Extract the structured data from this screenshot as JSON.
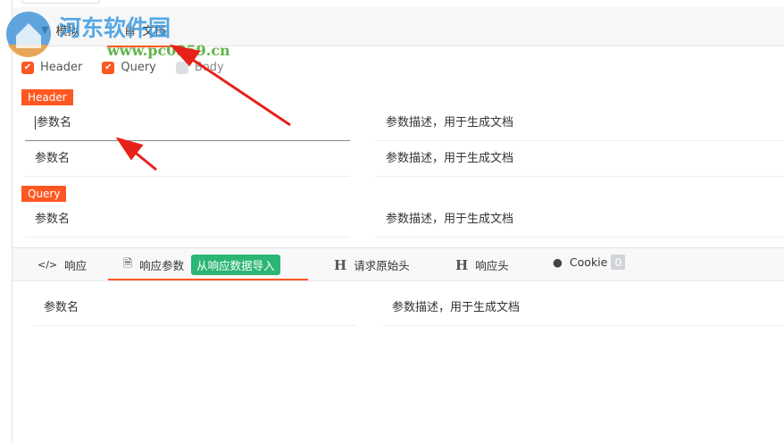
{
  "watermark": {
    "title": "河东软件园",
    "url": "www.pc0359.cn"
  },
  "top_tabs": [
    {
      "label": "模拟",
      "icon": "flask-icon"
    },
    {
      "label": "文档",
      "icon": "document-icon",
      "active": true
    }
  ],
  "checkboxes": [
    {
      "label": "Header",
      "checked": true
    },
    {
      "label": "Query",
      "checked": true
    },
    {
      "label": "Body",
      "checked": false
    }
  ],
  "sections": {
    "header": {
      "title": "Header",
      "rows": [
        {
          "name_placeholder": "参数名",
          "desc_placeholder": "参数描述，用于生成文档"
        },
        {
          "name_placeholder": "参数名",
          "desc_placeholder": "参数描述，用于生成文档"
        }
      ]
    },
    "query": {
      "title": "Query",
      "rows": [
        {
          "name_placeholder": "参数名",
          "desc_placeholder": "参数描述，用于生成文档"
        }
      ]
    }
  },
  "bottom_tabs": {
    "response": "响应",
    "response_params": "响应参数",
    "import_button": "从响应数据导入",
    "raw_request_headers": "请求原始头",
    "response_headers": "响应头",
    "cookie": "Cookie",
    "cookie_count": "0"
  },
  "response_params_rows": [
    {
      "name_placeholder": "参数名",
      "desc_placeholder": "参数描述，用于生成文档"
    }
  ],
  "colors": {
    "accent": "#ff5722",
    "green": "#2bb673"
  }
}
